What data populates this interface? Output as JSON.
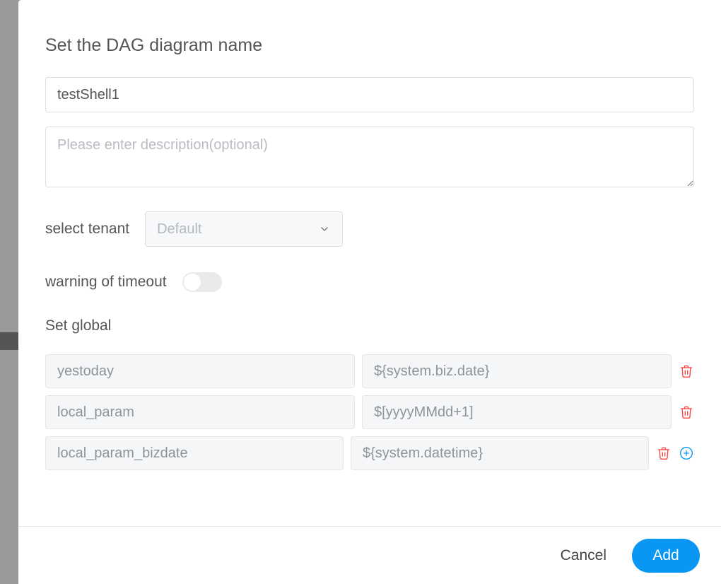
{
  "title": "Set the DAG diagram name",
  "name_value": "testShell1",
  "desc_placeholder": "Please enter description(optional)",
  "tenant": {
    "label": "select tenant",
    "selected": "Default"
  },
  "timeout": {
    "label": "warning of timeout",
    "enabled": false
  },
  "global": {
    "title": "Set global",
    "rows": [
      {
        "key": "yestoday",
        "value": "${system.biz.date}"
      },
      {
        "key": "local_param",
        "value": "$[yyyyMMdd+1]"
      },
      {
        "key": "local_param_bizdate",
        "value": "${system.datetime}"
      }
    ]
  },
  "footer": {
    "cancel": "Cancel",
    "add": "Add"
  }
}
